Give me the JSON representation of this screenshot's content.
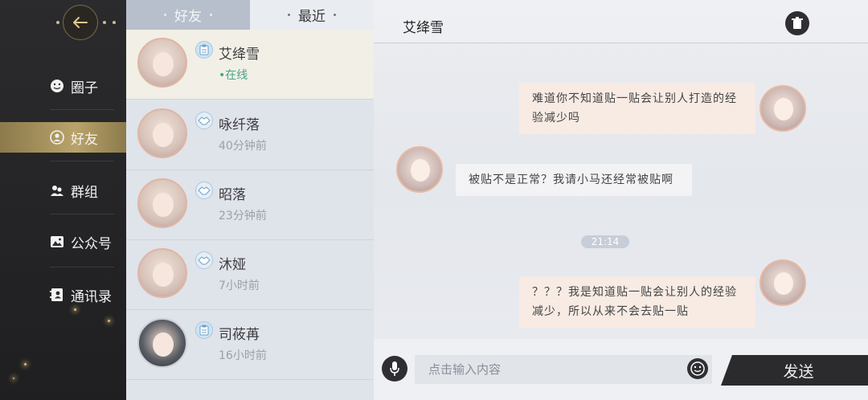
{
  "sidebar": {
    "back_icon": "arrow-left-icon",
    "items": [
      {
        "label": "圈子",
        "icon": "smile-icon"
      },
      {
        "label": "好友",
        "icon": "friend-icon"
      },
      {
        "label": "群组",
        "icon": "group-icon"
      },
      {
        "label": "公众号",
        "icon": "image-icon"
      },
      {
        "label": "通讯录",
        "icon": "contacts-icon"
      }
    ],
    "active_index": 1,
    "accent": "#b9a36a"
  },
  "list": {
    "tabs": [
      {
        "label": "好友",
        "active": true
      },
      {
        "label": "最近",
        "active": false
      }
    ],
    "friends": [
      {
        "name": "艾绛雪",
        "status": "•在线",
        "online": true,
        "badge": "clipboard-icon"
      },
      {
        "name": "咏纤落",
        "status": "40分钟前",
        "online": false,
        "badge": "handshake-icon"
      },
      {
        "name": "昭落",
        "status": "23分钟前",
        "online": false,
        "badge": "handshake-icon"
      },
      {
        "name": "沐娅",
        "status": "7小时前",
        "online": false,
        "badge": "handshake-icon"
      },
      {
        "name": "司莜苒",
        "status": "16小时前",
        "online": false,
        "badge": "clipboard-icon"
      }
    ]
  },
  "chat": {
    "title": "艾绛雪",
    "trash_icon": "trash-icon",
    "messages": [
      {
        "from": "me",
        "text": "难道你不知道贴一贴会让别人打造的经验减少吗"
      },
      {
        "from": "them",
        "text": "被贴不是正常？我请小马还经常被贴啊"
      },
      {
        "from": "me",
        "text": "？？？我是知道贴一贴会让别人的经验减少，所以从来不会去贴一贴"
      }
    ],
    "timestamp": "21:14",
    "input": {
      "placeholder": "点击输入内容",
      "value": ""
    },
    "send_label": "发送",
    "mic_icon": "mic-icon",
    "emoji_icon": "emoji-icon"
  }
}
